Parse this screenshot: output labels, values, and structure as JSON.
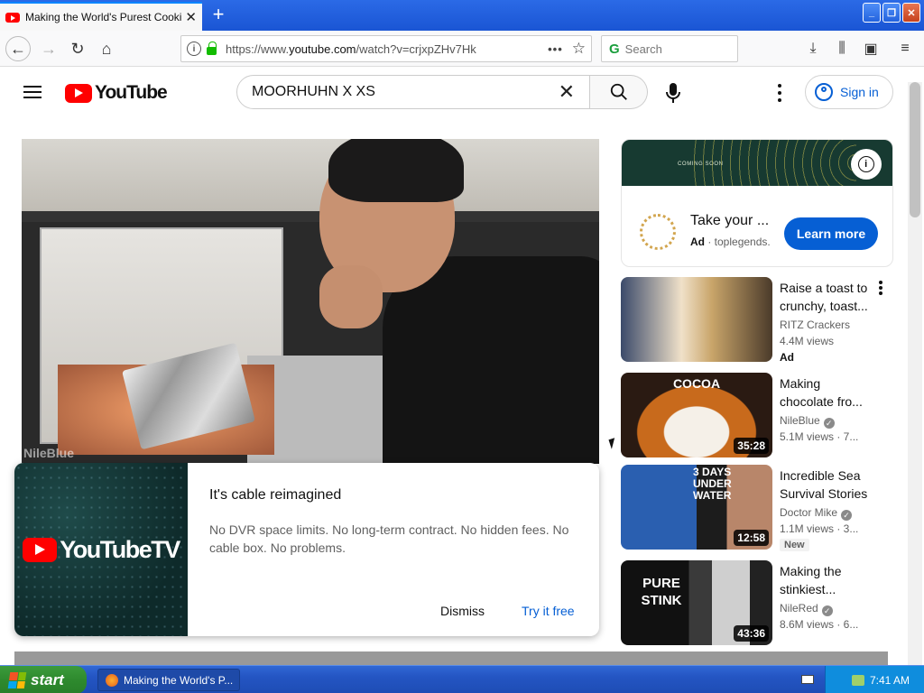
{
  "browser": {
    "tab_title": "Making the World's Purest Cookie",
    "url_prefix": "https://www.",
    "url_domain": "youtube.com",
    "url_path": "/watch?v=crjxpZHv7Hk",
    "search_placeholder": "Search"
  },
  "youtube": {
    "logo_text": "YouTube",
    "search_query": "MOORHUHN X XS",
    "sign_in": "Sign in",
    "player_watermark": "NileBlue",
    "overlay_ad": {
      "logo_text": "YouTubeTV",
      "heading": "It's cable reimagined",
      "body": "No DVR space limits. No long-term contract. No hidden fees. No cable box. No problems.",
      "dismiss": "Dismiss",
      "try": "Try it free"
    },
    "side_ad": {
      "banner_text": "COMING SOON",
      "title": "Take your ...",
      "ad_label": "Ad",
      "advertiser": "toplegends.",
      "cta": "Learn more"
    },
    "recommendations": [
      {
        "title": "Raise a toast to crunchy, toast...",
        "channel": "RITZ Crackers",
        "meta": "4.4M views",
        "badge": "Ad",
        "duration": ""
      },
      {
        "title": "Making chocolate fro...",
        "channel": "NileBlue",
        "meta": "5.1M views · 7...",
        "badge": "",
        "duration": "35:28",
        "thumb_text": "COCOA"
      },
      {
        "title": "Incredible Sea Survival Stories",
        "channel": "Doctor Mike",
        "meta": "1.1M views · 3...",
        "badge": "New",
        "duration": "12:58",
        "thumb_text": "3 DAYS UNDER WATER"
      },
      {
        "title": "Making the stinkiest...",
        "channel": "NileRed",
        "meta": "8.6M views · 6...",
        "badge": "",
        "duration": "43:36",
        "thumb_text": "PURE STINK"
      }
    ]
  },
  "taskbar": {
    "start": "start",
    "task_label": "Making the World's P...",
    "clock": "7:41 AM"
  },
  "colors": {
    "yt_red": "#ff0000",
    "yt_blue": "#065fd4",
    "xp_taskbar": "#245edb",
    "xp_start": "#3c9b3c"
  }
}
